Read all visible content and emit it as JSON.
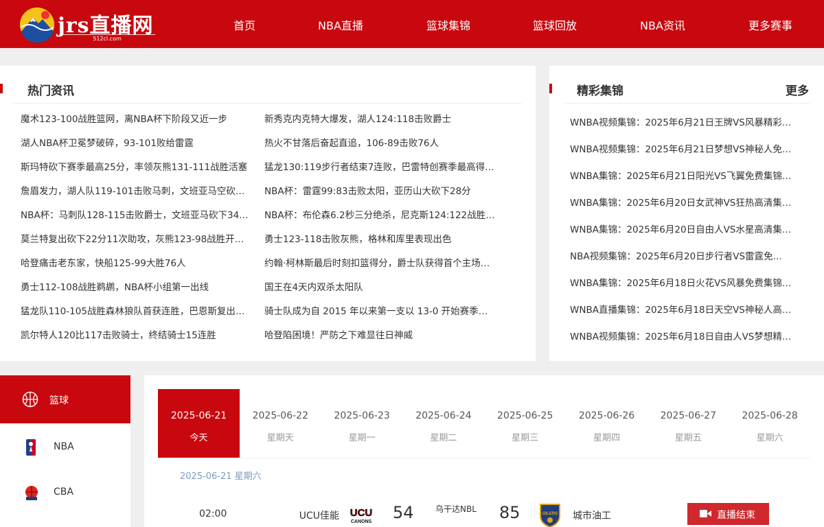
{
  "site": {
    "logo_text": "jrs直播网",
    "logo_sub": "512cl.com"
  },
  "nav": [
    "首页",
    "NBA直播",
    "篮球集锦",
    "篮球回放",
    "NBA资讯",
    "更多赛事"
  ],
  "hot_news": {
    "title": "热门资讯",
    "left": [
      "魔术123-100战胜篮网，离NBA杯下阶段又近一步",
      "湖人NBA杯卫冕梦破碎，93-101败给雷霆",
      "斯玛特砍下赛季最高25分，率领灰熊131-111战胜活塞",
      "詹眉发力，湖人队119-101击败马刺，文班亚马空砍…",
      "NBA杯：马刺队128-115击败爵士，文班亚马砍下34…",
      "莫兰特复出砍下22分11次助攻，灰熊123-98战胜开…",
      "哈登痛击老东家，快船125-99大胜76人",
      "勇士112-108战胜鹈鹕，NBA杯小组第一出线",
      "猛龙队110-105战胜森林狼队首获连胜，巴恩斯复出…",
      "凯尔特人120比117击败骑士，终结骑士15连胜"
    ],
    "right": [
      "新秀克内克特大爆发，湖人124:118击败爵士",
      "热火不甘落后奋起直追，106-89击败76人",
      "猛龙130:119步行者结束7连败，巴雷特创赛季最高得…",
      "NBA杯：雷霆99:83击败太阳，亚历山大砍下28分",
      "NBA杯：布伦森6.2秒三分绝杀，尼克斯124:122战胜…",
      "勇士123-118击败灰熊，格林和库里表现出色",
      "约翰·柯林斯最后时刻扣篮得分，爵士队获得首个主场…",
      "国王在4天内双杀太阳队",
      "骑士队成为自 2015 年以来第一支以 13-0 开始赛季…",
      "哈登陷困境！严防之下难显往日神威"
    ]
  },
  "highlights": {
    "title": "精彩集锦",
    "more": "更多",
    "items": [
      "WNBA视频集锦：2025年6月21日王牌VS风暴精彩…",
      "WNBA视频集锦：2025年6月21日梦想VS神秘人免…",
      "WNBA集锦：2025年6月21日阳光VS飞翼免费集锦…",
      "WNBA集锦：2025年6月20日女武神VS狂热高清集…",
      "WNBA集锦：2025年6月20日自由人VS水星高清集…",
      "NBA视频集锦：2025年6月20日步行者VS雷霆免…",
      "WNBA集锦：2025年6月18日火花VS风暴免费集锦…",
      "WNBA直播集锦：2025年6月18日天空VS神秘人高…",
      "WNBA视频集锦：2025年6月18日自由人VS梦想精…"
    ]
  },
  "sports_menu": [
    {
      "label": "篮球",
      "icon": "basketball-icon",
      "active": true
    },
    {
      "label": "NBA",
      "icon": "nba-logo-icon",
      "active": false
    },
    {
      "label": "CBA",
      "icon": "cba-logo-icon",
      "active": false
    }
  ],
  "dates": [
    {
      "date": "2025-06-21",
      "weekday": "今天",
      "active": true
    },
    {
      "date": "2025-06-22",
      "weekday": "星期天"
    },
    {
      "date": "2025-06-23",
      "weekday": "星期一"
    },
    {
      "date": "2025-06-24",
      "weekday": "星期二"
    },
    {
      "date": "2025-06-25",
      "weekday": "星期三"
    },
    {
      "date": "2025-06-26",
      "weekday": "星期四"
    },
    {
      "date": "2025-06-27",
      "weekday": "星期五"
    },
    {
      "date": "2025-06-28",
      "weekday": "星期六"
    }
  ],
  "schedule_heading": "2025-06-21 星期六",
  "match": {
    "time": "02:00",
    "home": "UCU佳能",
    "home_logo_text": "UCU",
    "home_logo_sub": "CANONS",
    "home_score": "54",
    "league": "乌干达NBL",
    "away_score": "85",
    "away": "城市油工",
    "away_logo_text": "OILERS",
    "button": "直播结束"
  },
  "colors": {
    "brand_red": "#c8080e",
    "button_red": "#d0282c",
    "date_blue": "#7b9bbd"
  }
}
